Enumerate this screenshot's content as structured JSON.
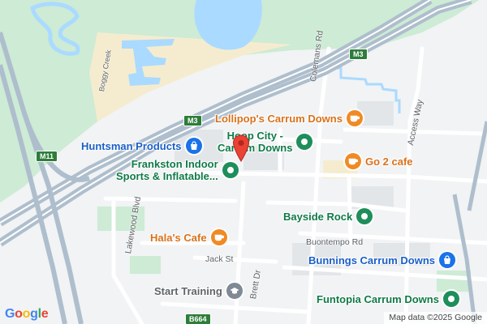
{
  "map": {
    "colors": {
      "land": "#f1f3f4",
      "park": "#cdebd5",
      "water": "#aadaff",
      "sand": "#f5eccf",
      "motorway": "#aebecd",
      "road": "#ffffff",
      "marker": "#ea4335"
    },
    "center_marker": {
      "icon": "red-map-pin-icon"
    },
    "shields": {
      "m3_top": "M3",
      "m3_mid": "M3",
      "m11": "M11",
      "b664": "B664"
    },
    "streets": {
      "colemans_rd": "Colemans Rd",
      "access_way": "Access Way",
      "boggy_creek": "Boggy Creek",
      "lakewood_blvd": "Lakewood Blvd",
      "buontempo_rd": "Buontempo Rd",
      "jack_st": "Jack St",
      "brett_dr": "Brett Dr"
    },
    "places": {
      "lollipops": {
        "name": "Lollipop's Carrum Downs",
        "icon": "cafe-icon"
      },
      "hoop_city": {
        "name_line1": "Hoop City -",
        "name_line2": "Carrum Downs",
        "icon": "leisure-icon"
      },
      "huntsman": {
        "name": "Huntsman Products",
        "icon": "shopping-bag-icon"
      },
      "frankston_indoor": {
        "name_line1": "Frankston Indoor",
        "name_line2": "Sports & Inflatable...",
        "icon": "leisure-icon"
      },
      "go2cafe": {
        "name": "Go 2 cafe",
        "icon": "cafe-icon"
      },
      "bayside_rock": {
        "name": "Bayside Rock",
        "icon": "leisure-icon"
      },
      "halas_cafe": {
        "name": "Hala's Cafe",
        "icon": "cafe-icon"
      },
      "bunnings": {
        "name": "Bunnings Carrum Downs",
        "icon": "shopping-bag-icon"
      },
      "start_training": {
        "name": "Start Training",
        "icon": "school-icon"
      },
      "funtopia": {
        "name": "Funtopia Carrum Downs",
        "icon": "leisure-icon"
      }
    },
    "branding": {
      "logo_text": "Google",
      "attribution": "Map data ©2025 Google"
    }
  }
}
